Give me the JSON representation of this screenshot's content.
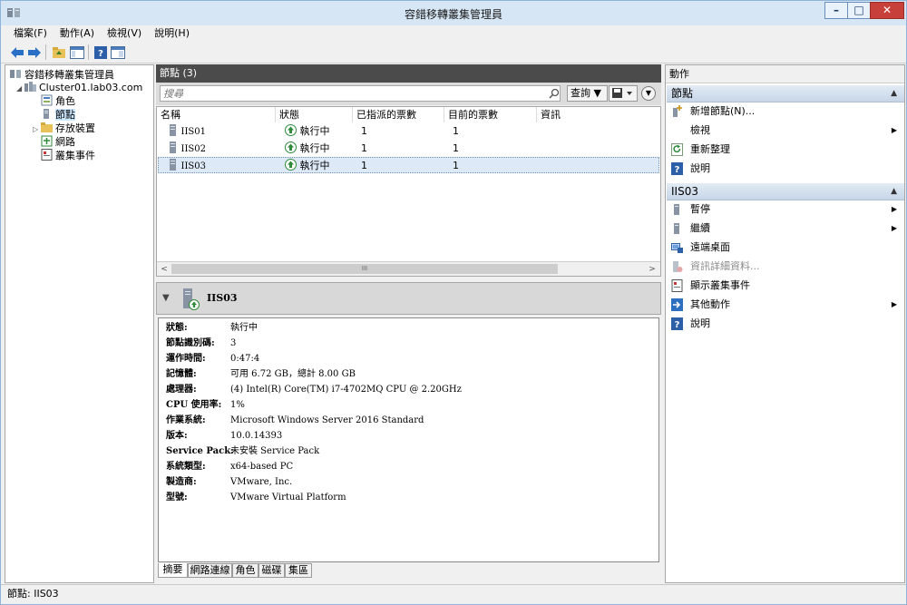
{
  "window": {
    "title": "容錯移轉叢集管理員",
    "min": "–",
    "max": "□",
    "close": "✕"
  },
  "menu": [
    "檔案(F)",
    "動作(A)",
    "檢視(V)",
    "說明(H)"
  ],
  "tree": {
    "root": "容錯移轉叢集管理員",
    "cluster": "Cluster01.lab03.com",
    "items": [
      "角色",
      "節點",
      "存放裝置",
      "網路",
      "叢集事件"
    ],
    "selected": "節點"
  },
  "nodes_panel": {
    "title": "節點 (3)",
    "search_placeholder": "搜尋",
    "query_label": "查詢 ▼",
    "columns": [
      "名稱",
      "狀態",
      "已指派的票數",
      "目前的票數",
      "資訊"
    ],
    "rows": [
      {
        "name": "IIS01",
        "status": "執行中",
        "assigned": "1",
        "current": "1"
      },
      {
        "name": "IIS02",
        "status": "執行中",
        "assigned": "1",
        "current": "1"
      },
      {
        "name": "IIS03",
        "status": "執行中",
        "assigned": "1",
        "current": "1"
      }
    ],
    "scroll_left": "<",
    "scroll_right": ">",
    "scroll_grip": "III"
  },
  "detail": {
    "title": "IIS03",
    "props": [
      {
        "k": "狀態:",
        "v": "執行中"
      },
      {
        "k": "節點識別碼:",
        "v": "3"
      },
      {
        "k": "運作時間:",
        "v": "0:47:4"
      },
      {
        "k": "記憶體:",
        "v": "可用 6.72 GB，總計 8.00 GB"
      },
      {
        "k": "處理器:",
        "v": "(4) Intel(R) Core(TM) i7-4702MQ CPU @ 2.20GHz"
      },
      {
        "k": "CPU 使用率:",
        "v": "1%"
      },
      {
        "k": "作業系統:",
        "v": "Microsoft Windows Server 2016 Standard"
      },
      {
        "k": "版本:",
        "v": "10.0.14393"
      },
      {
        "k": "Service Pack:",
        "v": "未安裝 Service Pack"
      },
      {
        "k": "系統類型:",
        "v": "x64-based PC"
      },
      {
        "k": "製造商:",
        "v": "VMware, Inc."
      },
      {
        "k": "型號:",
        "v": "VMware Virtual Platform"
      }
    ],
    "tabs": [
      "摘要",
      "網路連線",
      "角色",
      "磁碟",
      "集區"
    ]
  },
  "actions": {
    "title": "動作",
    "group1": "節點",
    "group1_items": [
      "新增節點(N)...",
      "檢視",
      "重新整理",
      "說明"
    ],
    "group2": "IIS03",
    "group2_items": [
      "暫停",
      "繼續",
      "遠端桌面",
      "資訊詳細資料...",
      "顯示叢集事件",
      "其他動作",
      "說明"
    ]
  },
  "status": "節點: IIS03",
  "colors": {
    "title_bg": "#d6e6f5",
    "panel_header": "#4b4b4b",
    "selection": "#dde9f6",
    "group_bg": "#c7d6e8"
  }
}
